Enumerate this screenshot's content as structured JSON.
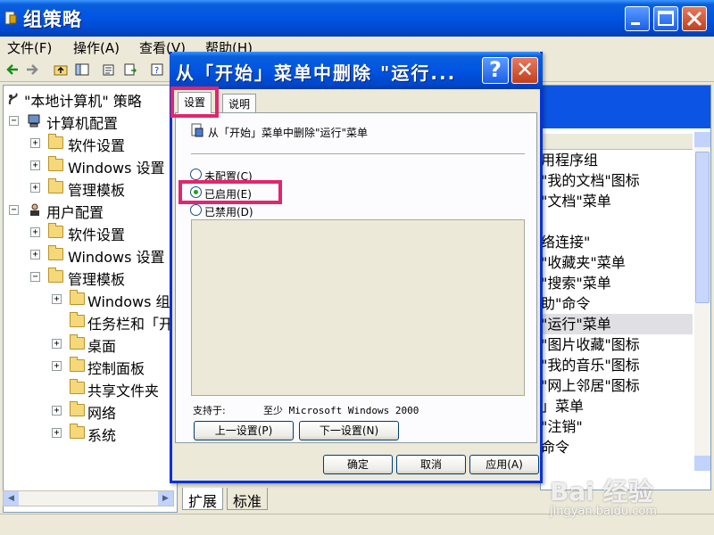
{
  "main_window": {
    "title": "组策略",
    "menu": [
      "文件(F)",
      "操作(A)",
      "查看(V)",
      "帮助(H)"
    ]
  },
  "tree": {
    "items": [
      {
        "label": "\"本地计算机\" 策略",
        "expander": ""
      },
      {
        "label": "计算机配置",
        "expander": "−"
      },
      {
        "label": "软件设置",
        "expander": "+"
      },
      {
        "label": "Windows 设置",
        "expander": "+"
      },
      {
        "label": "管理模板",
        "expander": "+"
      },
      {
        "label": "用户配置",
        "expander": "−"
      },
      {
        "label": "软件设置",
        "expander": "+"
      },
      {
        "label": "Windows 设置",
        "expander": "+"
      },
      {
        "label": "管理模板",
        "expander": "−"
      },
      {
        "label": "Windows 组",
        "expander": "+"
      },
      {
        "label": "任务栏和「开",
        "expander": ""
      },
      {
        "label": "桌面",
        "expander": "+"
      },
      {
        "label": "控制面板",
        "expander": "+"
      },
      {
        "label": "共享文件夹",
        "expander": ""
      },
      {
        "label": "网络",
        "expander": "+"
      },
      {
        "label": "系统",
        "expander": "+"
      }
    ]
  },
  "right_list": {
    "items": [
      "用程序组",
      "\"我的文档\"图标",
      "\"文档\"菜单",
      "",
      "络连接\"",
      "\"收藏夹\"菜单",
      "\"搜索\"菜单",
      "助\"命令",
      "\"运行\"菜单",
      "\"图片收藏\"图标",
      "\"我的音乐\"图标",
      "\"网上邻居\"图标",
      "」菜单",
      "\"注销\"",
      "命令"
    ],
    "selected_index": 8
  },
  "bottom_tabs": [
    "扩展",
    "标准"
  ],
  "watermark": {
    "text": "Bai 经验",
    "sub": "jingyan.baidu.com"
  },
  "dialog": {
    "title": "从「开始」菜单中删除 \"运行...",
    "help_glyph": "?",
    "close_glyph": "✕",
    "tabs": [
      "设置",
      "说明"
    ],
    "policy_name": "从「开始」菜单中删除\"运行\"菜单",
    "options": [
      "未配置(C)",
      "已启用(E)",
      "已禁用(D)"
    ],
    "selected_option": 1,
    "support_label": "支持于:",
    "support_value": "至少 Microsoft Windows 2000",
    "prev_button": "上一设置(P)",
    "next_button": "下一设置(N)",
    "ok_button": "确定",
    "cancel_button": "取消",
    "apply_button": "应用(A)"
  },
  "colors": {
    "titlebar": "#0054e3",
    "highlight": "#e0266e",
    "radio_dot": "#21a121"
  }
}
